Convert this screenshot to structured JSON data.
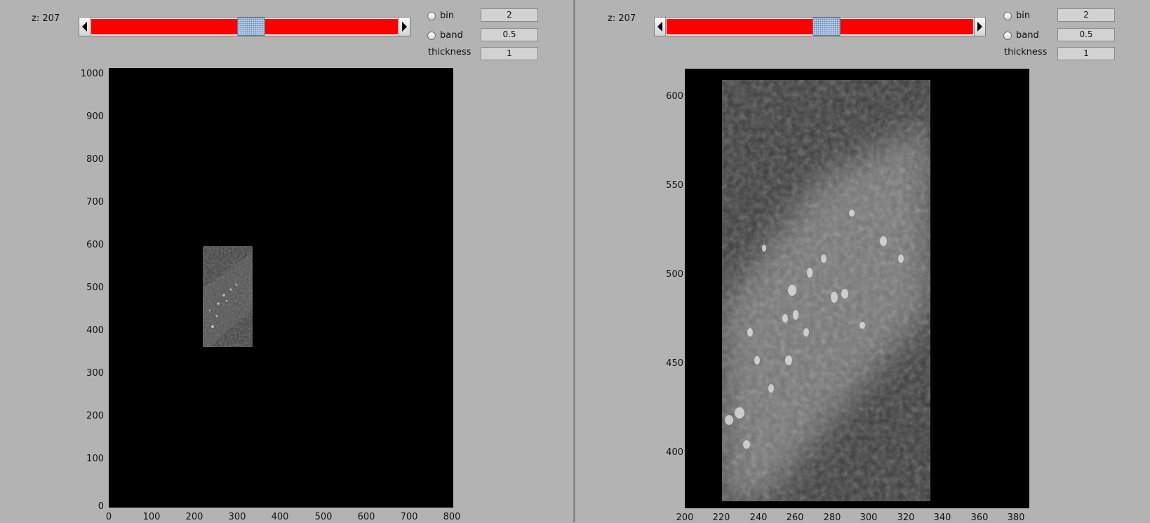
{
  "left_panel": {
    "z_label": "z: 207",
    "options": {
      "bin_label": "bin",
      "bin_value": "2",
      "band_label": "band",
      "band_value": "0.5",
      "thickness_label": "thickness",
      "thickness_value": "1"
    },
    "axes": {
      "y_ticks": [
        "1000",
        "900",
        "800",
        "700",
        "600",
        "500",
        "400",
        "300",
        "200",
        "100",
        "0"
      ],
      "x_ticks": [
        "0",
        "100",
        "200",
        "300",
        "400",
        "500",
        "600",
        "700",
        "800"
      ]
    }
  },
  "right_panel": {
    "z_label": "z: 207",
    "options": {
      "bin_label": "bin",
      "bin_value": "2",
      "band_label": "band",
      "band_value": "0.5",
      "thickness_label": "thickness",
      "thickness_value": "1"
    },
    "axes": {
      "y_ticks": [
        "600",
        "550",
        "500",
        "450",
        "400"
      ],
      "x_ticks": [
        "200",
        "220",
        "240",
        "260",
        "280",
        "300",
        "320",
        "340",
        "360",
        "380"
      ]
    }
  },
  "colors": {
    "slider_track": "#ff0000",
    "slider_thumb": "#b7cbe6",
    "panel_bg": "#b3b3b3",
    "plot_bg": "#000000"
  },
  "icons": {
    "slider_left_arrow": "triangle-left-icon",
    "slider_right_arrow": "triangle-right-icon"
  }
}
